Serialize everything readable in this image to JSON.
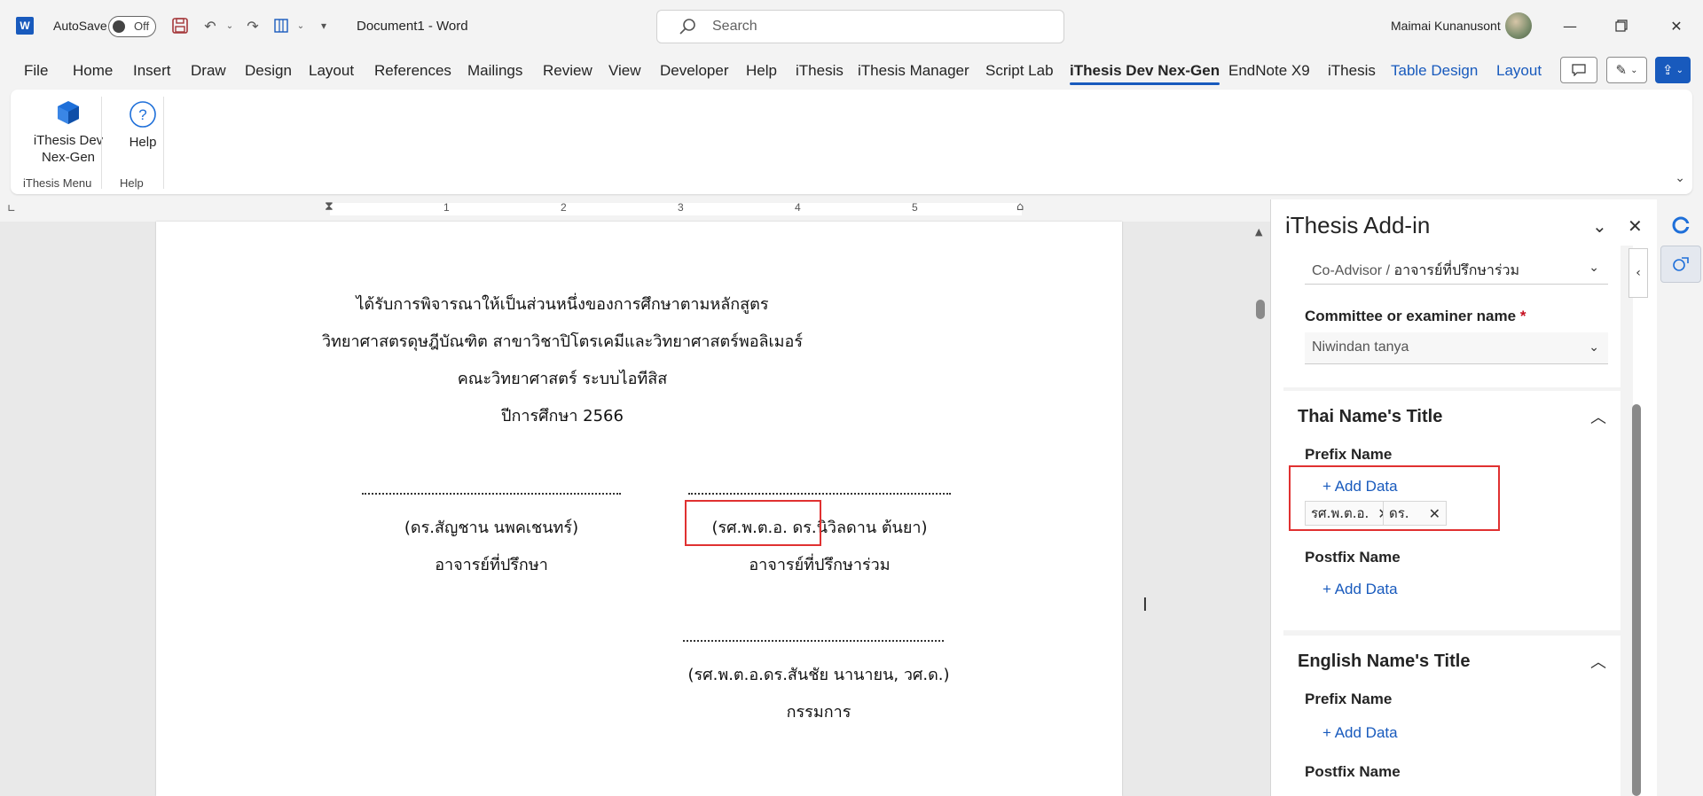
{
  "titlebar": {
    "autosave_label": "AutoSave",
    "autosave_state": "Off",
    "doc_title": "Document1  -  Word",
    "search_placeholder": "Search",
    "user_name": "Maimai Kunanusont"
  },
  "menu": {
    "items": [
      "File",
      "Home",
      "Insert",
      "Draw",
      "Design",
      "Layout",
      "References",
      "Mailings",
      "Review",
      "View",
      "Developer",
      "Help",
      "iThesis",
      "iThesis Manager",
      "Script Lab",
      "iThesis Dev Nex-Gen",
      "EndNote X9",
      "iThesis",
      "Table Design",
      "Layout"
    ],
    "active_index": 15
  },
  "ribbon": {
    "ithesis_dev_label": "iThesis Dev\nNex-Gen",
    "ithesis_dev_line1": "iThesis Dev",
    "ithesis_dev_line2": "Nex-Gen",
    "help_label": "Help",
    "group_ithesis_menu": "iThesis Menu",
    "group_help": "Help"
  },
  "ruler": {
    "numbers": [
      "1",
      "2",
      "3",
      "4",
      "5"
    ]
  },
  "document": {
    "line1": "ได้รับการพิจารณาให้เป็นส่วนหนึ่งของการศึกษาตามหลักสูตร",
    "line2": "วิทยาศาสตรดุษฎีบัณฑิต สาขาวิชาปิโตรเคมีและวิทยาศาสตร์พอลิเมอร์",
    "line3": "คณะวิทยาศาสตร์ ระบบไอทีสิส",
    "line4": "ปีการศึกษา 2566",
    "sig1_name": "(ดร.สัญชาน นพคเชนทร์)",
    "sig1_role": "อาจารย์ที่ปรึกษา",
    "sig2_name": "(รศ.พ.ต.อ. ดร.นิวิลดาน ต้นยา)",
    "sig2_role": "อาจารย์ที่ปรึกษาร่วม",
    "sig3_name": "(รศ.พ.ต.อ.ดร.สันชัย นานายน, วศ.ด.)",
    "sig3_role": "กรรมการ"
  },
  "pane": {
    "title": "iThesis Add-in",
    "type_value_prefix": "Co-Advisor / ",
    "type_value_thai": "อาจารย์ที่ปรึกษาร่วม",
    "committee_label": "Committee or examiner name",
    "required_mark": "*",
    "committee_value": "Niwindan tanya",
    "thai_section_title": "Thai Name's Title",
    "prefix_label": "Prefix Name",
    "add_data": "+ Add Data",
    "tag1": "รศ.พ.ต.อ.",
    "tag2": "ดร.",
    "postfix_label": "Postfix Name",
    "english_section_title": "English Name's Title"
  },
  "colors": {
    "accent": "#185abd",
    "highlight_red": "#e03131"
  }
}
